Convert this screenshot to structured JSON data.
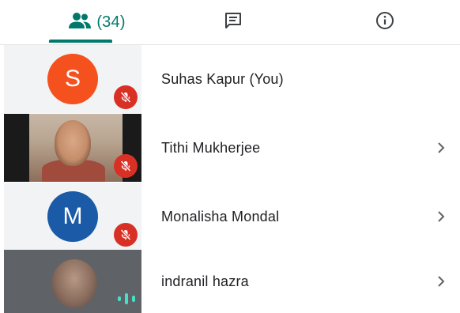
{
  "tabs": {
    "people_count": "(34)",
    "active": "people"
  },
  "colors": {
    "accent": "#00796b",
    "mute_badge": "#d93025",
    "avatar_s": "#f4511e",
    "avatar_m": "#1a5aa6",
    "speaking": "#46e0c6"
  },
  "icons": {
    "people_tab": "people-icon",
    "chat_tab": "chat-icon",
    "info_tab": "info-icon",
    "muted": "mic-off-icon",
    "speaking": "audio-level-icon",
    "open": "chevron-right-icon"
  },
  "participants": [
    {
      "initial": "S",
      "name": "Suhas Kapur (You)",
      "state": "muted"
    },
    {
      "initial": "",
      "name": "Tithi Mukherjee",
      "state": "muted"
    },
    {
      "initial": "M",
      "name": "Monalisha Mondal",
      "state": "muted"
    },
    {
      "initial": "",
      "name": "indranil hazra",
      "state": "speaking"
    }
  ]
}
